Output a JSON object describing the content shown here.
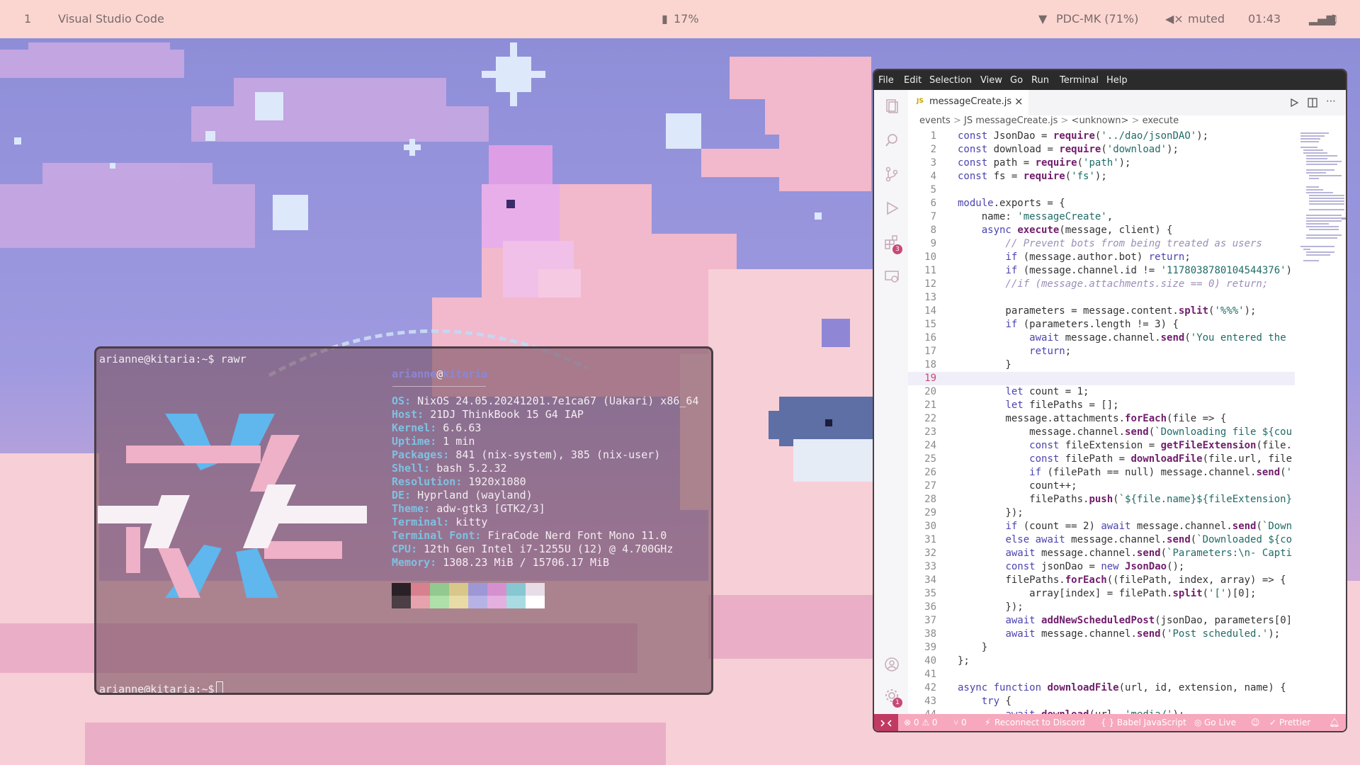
{
  "topbar": {
    "workspace": "1",
    "window_title": "Visual Studio Code",
    "battery": "17%",
    "network": "PDC-MK (71%)",
    "volume": "muted",
    "clock": "01:43"
  },
  "terminal": {
    "prompt1": "arianne@kitaria:~$ rawr",
    "fetch_title_user": "arianne",
    "fetch_title_at": "@",
    "fetch_title_host": "kitaria",
    "rows": [
      {
        "key": "OS",
        "value": "NixOS 24.05.20241201.7e1ca67 (Uakari) x86_64"
      },
      {
        "key": "Host",
        "value": "21DJ ThinkBook 15 G4 IAP"
      },
      {
        "key": "Kernel",
        "value": "6.6.63"
      },
      {
        "key": "Uptime",
        "value": "1 min"
      },
      {
        "key": "Packages",
        "value": "841 (nix-system), 385 (nix-user)"
      },
      {
        "key": "Shell",
        "value": "bash 5.2.32"
      },
      {
        "key": "Resolution",
        "value": "1920x1080"
      },
      {
        "key": "DE",
        "value": "Hyprland (wayland)"
      },
      {
        "key": "Theme",
        "value": "adw-gtk3 [GTK2/3]"
      },
      {
        "key": "Terminal",
        "value": "kitty"
      },
      {
        "key": "Terminal Font",
        "value": "FiraCode Nerd Font Mono 11.0"
      },
      {
        "key": "CPU",
        "value": "12th Gen Intel i7-1255U (12) @ 4.700GHz"
      },
      {
        "key": "Memory",
        "value": "1308.23 MiB / 15706.17 MiB"
      }
    ],
    "palette_top": [
      "#2a2126",
      "#d8808e",
      "#92c98f",
      "#d9c789",
      "#9d97d6",
      "#d591cf",
      "#86c7d1",
      "#e7dde6"
    ],
    "palette_bottom": [
      "#4b3e45",
      "#e6a2ad",
      "#aee0a9",
      "#e8dba6",
      "#b7b2e6",
      "#e4b0df",
      "#a9dbe2",
      "#ffffff"
    ],
    "prompt2": "arianne@kitaria:~$"
  },
  "vscode": {
    "menu": [
      "File",
      "Edit",
      "Selection",
      "View",
      "Go",
      "Run",
      "Terminal",
      "Help"
    ],
    "tab_icon": "JS",
    "tab_label": "messageCreate.js",
    "tab_close": "×",
    "breadcrumb": [
      "events",
      "JS messageCreate.js",
      "<unknown>",
      "execute"
    ],
    "breadcrumb_sep": ">",
    "extensions_badge": "3",
    "settings_badge": "1",
    "code_lines": [
      "const JsonDao = require('../dao/jsonDAO');",
      "const download = require('download');",
      "const path = require('path');",
      "const fs = require('fs');",
      "",
      "module.exports = {",
      "    name: 'messageCreate',",
      "    async execute(message, client) {",
      "        // Prevent bots from being treated as users",
      "        if (message.author.bot) return;",
      "        if (message.channel.id != '1178038780104544376')",
      "        //if (message.attachments.size == 0) return;",
      "",
      "        parameters = message.content.split('%%%');",
      "        if (parameters.length != 3) {",
      "            await message.channel.send('You entered the",
      "            return;",
      "        }",
      "",
      "        let count = 1;",
      "        let filePaths = [];",
      "        message.attachments.forEach(file => {",
      "            message.channel.send(`Downloading file ${cou",
      "            const fileExtension = getFileExtension(file.",
      "            const filePath = downloadFile(file.url, file",
      "            if (filePath == null) message.channel.send('",
      "            count++;",
      "            filePaths.push(`${file.name}${fileExtension}",
      "        });",
      "        if (count == 2) await message.channel.send(`Down",
      "        else await message.channel.send(`Downloaded ${co",
      "        await message.channel.send(`Parameters:\\n- Capti",
      "        const jsonDao = new JsonDao();",
      "        filePaths.forEach((filePath, index, array) => {",
      "            array[index] = filePath.split('[')[0];",
      "        });",
      "        await addNewScheduledPost(jsonDao, parameters[0]",
      "        await message.channel.send('Post scheduled.');",
      "    }",
      "};",
      "",
      "async function downloadFile(url, id, extension, name) {",
      "    try {",
      "        await download(url, 'media/');"
    ],
    "status": {
      "problems": "⊗ 0 ⚠ 0",
      "ports": "⑂ 0",
      "discord": "Reconnect to Discord",
      "language": "{ } Babel JavaScript",
      "golive": "Go Live",
      "prettier": "Prettier"
    }
  }
}
